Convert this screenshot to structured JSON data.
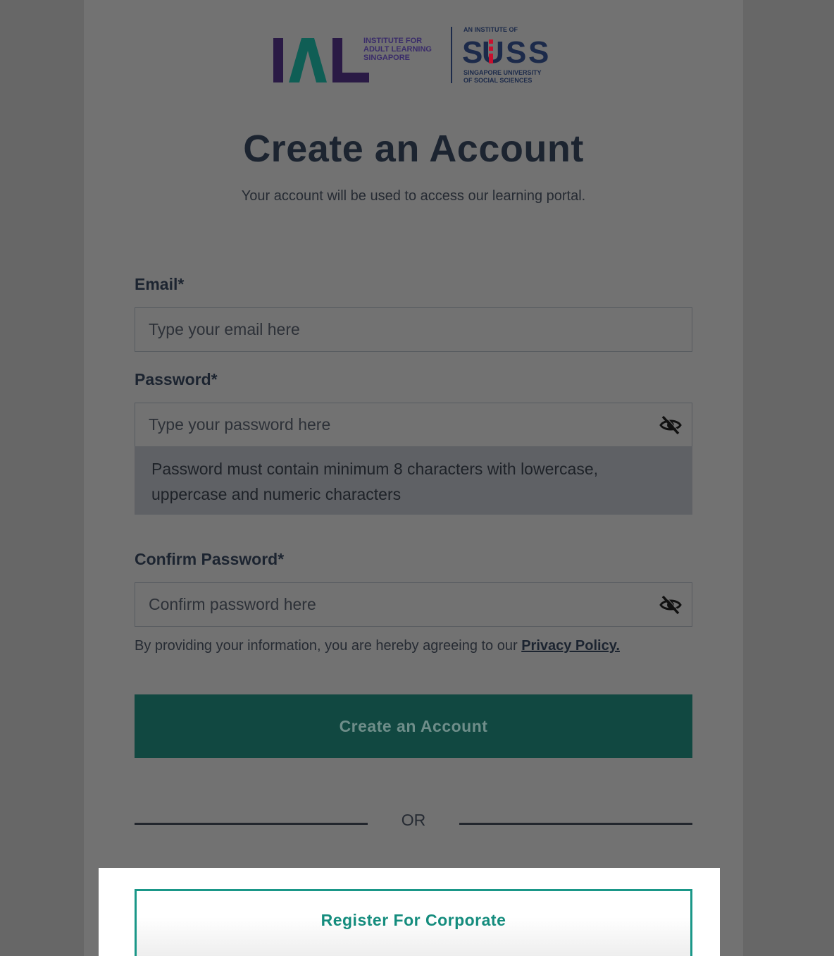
{
  "logo": {
    "ial_mark": "IAL",
    "ial_name_lines": [
      "INSTITUTE FOR",
      "ADULT LEARNING",
      "SINGAPORE"
    ],
    "suss_tagline": "AN INSTITUTE OF",
    "suss_mark": "SUSS",
    "suss_name_lines": [
      "SINGAPORE UNIVERSITY",
      "OF SOCIAL SCIENCES"
    ]
  },
  "page": {
    "title": "Create an Account",
    "subtitle": "Your account will be used to access our learning portal."
  },
  "form": {
    "email_label": "Email*",
    "email_placeholder": "Type your email here",
    "password_label": "Password*",
    "password_placeholder": "Type your password here",
    "password_hint": "Password must contain minimum 8 characters with lowercase, uppercase and numeric characters",
    "confirm_label": "Confirm Password*",
    "confirm_placeholder": "Confirm password here",
    "agreement_text": "By providing your information, you are hereby agreeing to our ",
    "privacy_link": "Privacy Policy.",
    "submit_label": "Create an Account",
    "divider_text": "OR",
    "corporate_label": "Register For Corporate"
  },
  "icons": {
    "password_toggle": "eye-slash-icon",
    "confirm_toggle": "eye-slash-icon"
  },
  "colors": {
    "primary_button": "#114841",
    "corporate_accent": "#1a9788",
    "ial_purple": "#2d1a4f",
    "ial_teal": "#0f6e63",
    "suss_navy": "#1c2a4a",
    "suss_red": "#c8102e"
  }
}
